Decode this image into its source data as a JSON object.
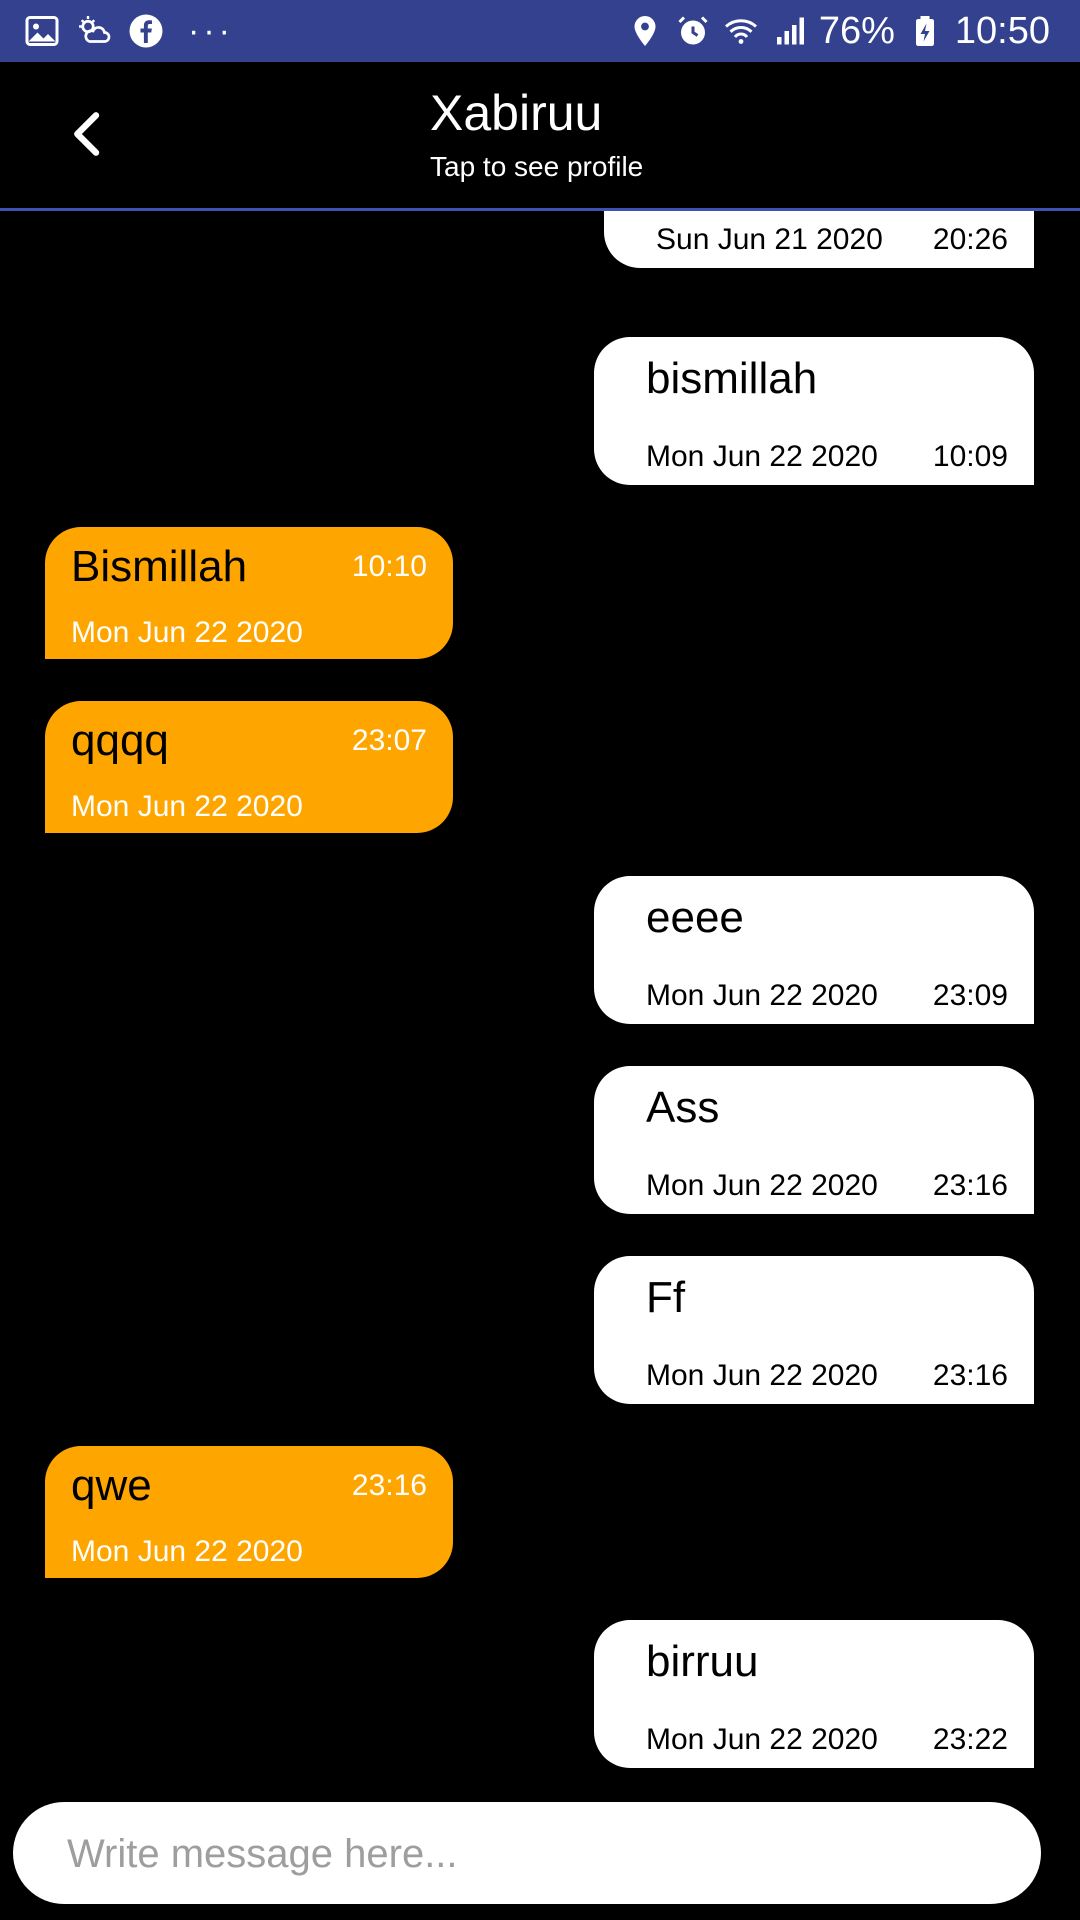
{
  "status_bar": {
    "left_icons": [
      "gallery-icon",
      "weather-icon",
      "facebook-icon"
    ],
    "more": "···",
    "battery": "76%",
    "time": "10:50",
    "right_icons": [
      "location-icon",
      "alarm-icon",
      "wifi-icon",
      "signal-icon",
      "battery-icon"
    ]
  },
  "header": {
    "title": "Xabiruu",
    "subtitle": "Tap to see profile",
    "back_icon": "chevron-left-icon"
  },
  "messages": [
    {
      "side": "sent",
      "text": "",
      "date": "Sun Jun 21 2020",
      "time": "20:26"
    },
    {
      "side": "sent",
      "text": "bismillah",
      "date": "Mon Jun 22 2020",
      "time": "10:09"
    },
    {
      "side": "recv",
      "text": "Bismillah",
      "date": "Mon Jun 22 2020",
      "time": "10:10"
    },
    {
      "side": "recv",
      "text": "qqqq",
      "date": "Mon Jun 22 2020",
      "time": "23:07"
    },
    {
      "side": "sent",
      "text": "eeee",
      "date": "Mon Jun 22 2020",
      "time": "23:09"
    },
    {
      "side": "sent",
      "text": "Ass",
      "date": "Mon Jun 22 2020",
      "time": "23:16"
    },
    {
      "side": "sent",
      "text": "Ff",
      "date": "Mon Jun 22 2020",
      "time": "23:16"
    },
    {
      "side": "recv",
      "text": "qwe",
      "date": "Mon Jun 22 2020",
      "time": "23:16"
    },
    {
      "side": "sent",
      "text": "birruu",
      "date": "Mon Jun 22 2020",
      "time": "23:22"
    }
  ],
  "composer": {
    "placeholder": "Write message here...",
    "value": ""
  },
  "colors": {
    "status_bar": "#33418f",
    "accent_line": "#3f51b5",
    "received_bubble": "#ffa500",
    "sent_bubble": "#ffffff",
    "background": "#000000"
  }
}
